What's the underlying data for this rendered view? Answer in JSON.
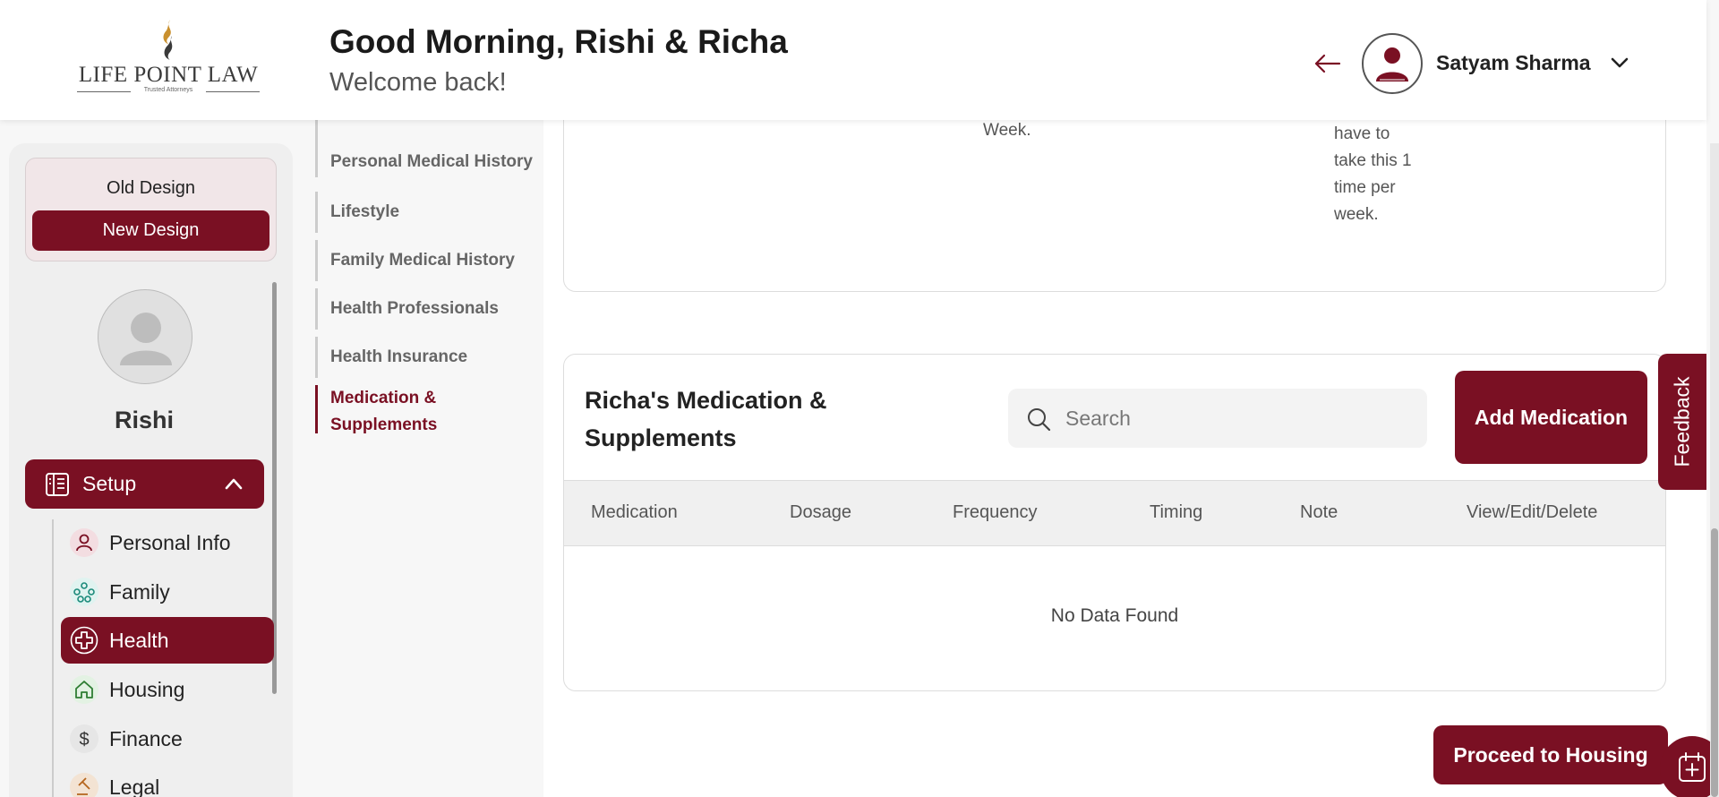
{
  "header": {
    "logo_name": "LIFE POINT LAW",
    "logo_tagline": "Trusted Attorneys",
    "greeting": "Good Morning, Rishi & Richa",
    "welcome": "Welcome back!",
    "user_name": "Satyam Sharma"
  },
  "sidebar": {
    "old_design": "Old Design",
    "new_design": "New Design",
    "profile_name": "Rishi",
    "setup_label": "Setup",
    "items": [
      {
        "label": "Personal Info",
        "icon": "person-icon"
      },
      {
        "label": "Family",
        "icon": "family-icon"
      },
      {
        "label": "Health",
        "icon": "health-plus-icon",
        "active": true
      },
      {
        "label": "Housing",
        "icon": "house-icon"
      },
      {
        "label": "Finance",
        "icon": "dollar-icon"
      },
      {
        "label": "Legal",
        "icon": "legal-icon"
      }
    ]
  },
  "subnav": {
    "items": [
      {
        "label": "Personal Medical History"
      },
      {
        "label": "Lifestyle"
      },
      {
        "label": "Family Medical History"
      },
      {
        "label": "Health Professionals"
      },
      {
        "label": "Health Insurance"
      },
      {
        "label": "Medication & Supplements",
        "active": true
      }
    ]
  },
  "top_card": {
    "frequency_text": "Week.",
    "note_text": "have to take this 1 time per week."
  },
  "med_card": {
    "title": "Richa's Medication & Supplements",
    "search_placeholder": "Search",
    "add_button": "Add Medication",
    "columns": [
      "Medication",
      "Dosage",
      "Frequency",
      "Timing",
      "Note",
      "View/Edit/Delete"
    ],
    "empty_text": "No Data Found"
  },
  "proceed_button": "Proceed to Housing",
  "feedback_label": "Feedback",
  "colors": {
    "brand": "#7a1023",
    "background": "#f7f7f7"
  }
}
